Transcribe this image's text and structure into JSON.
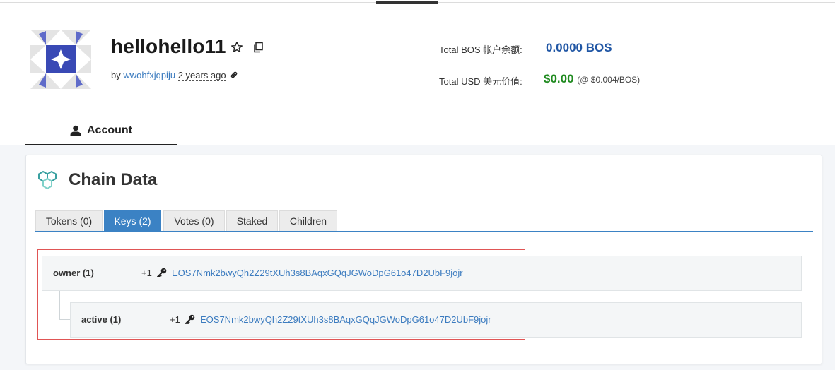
{
  "account": {
    "name": "hellohello11",
    "by_label": "by",
    "author": "wwohfxjqpiju",
    "created": "2 years ago"
  },
  "stats": {
    "bos_label": "Total BOS 帐户余额:",
    "bos_value": "0.0000 BOS",
    "usd_label": "Total USD 美元价值:",
    "usd_value": "$0.00",
    "usd_rate": "(@ $0.004/BOS)",
    "bos_color": "#2157a5",
    "usd_color": "#1f8a1f"
  },
  "nav": {
    "account_tab": "Account"
  },
  "chain": {
    "title": "Chain Data",
    "tabs": [
      {
        "label": "Tokens (0)",
        "active": false
      },
      {
        "label": "Keys (2)",
        "active": true
      },
      {
        "label": "Votes (0)",
        "active": false
      },
      {
        "label": "Staked",
        "active": false
      },
      {
        "label": "Children",
        "active": false
      }
    ],
    "permissions": [
      {
        "name": "owner (1)",
        "weight": "+1",
        "key": "EOS7Nmk2bwyQh2Z29tXUh3s8BAqxGQqJGWoDpG61o47D2UbF9jojr"
      },
      {
        "name": "active (1)",
        "weight": "+1",
        "key": "EOS7Nmk2bwyQh2Z29tXUh3s8BAqxGQqJGWoDpG61o47D2UbF9jojr"
      }
    ],
    "accent_color": "#3b82c4"
  },
  "icons": [
    "avatar-identicon",
    "star-icon",
    "copy-icon",
    "link-icon",
    "user-icon",
    "chain-icon",
    "key-icon"
  ]
}
